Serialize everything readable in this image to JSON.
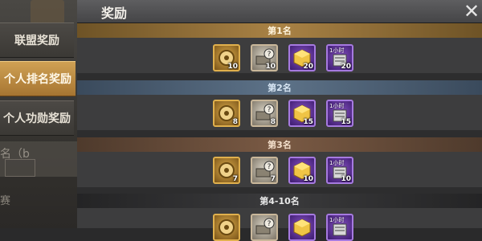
{
  "sidebar": {
    "tabs": [
      {
        "label": "联盟奖励"
      },
      {
        "label": "个人排名奖励"
      },
      {
        "label": "个人功勋奖励"
      }
    ],
    "background_text": [
      "名（b",
      "赛"
    ]
  },
  "panel": {
    "title": "奖励"
  },
  "ranks": [
    {
      "label": "第1名",
      "items": [
        {
          "icon": "gear-medal-icon",
          "count": "10"
        },
        {
          "icon": "mystery-crate-icon",
          "count": "10"
        },
        {
          "icon": "gold-cube-icon",
          "count": "20"
        },
        {
          "icon": "speedup-scroll-icon",
          "count": "20",
          "time_label": "1小时"
        }
      ]
    },
    {
      "label": "第2名",
      "items": [
        {
          "icon": "gear-medal-icon",
          "count": "8"
        },
        {
          "icon": "mystery-crate-icon",
          "count": "8"
        },
        {
          "icon": "gold-cube-icon",
          "count": "15"
        },
        {
          "icon": "speedup-scroll-icon",
          "count": "15",
          "time_label": "1小时"
        }
      ]
    },
    {
      "label": "第3名",
      "items": [
        {
          "icon": "gear-medal-icon",
          "count": "7"
        },
        {
          "icon": "mystery-crate-icon",
          "count": "7"
        },
        {
          "icon": "gold-cube-icon",
          "count": "10"
        },
        {
          "icon": "speedup-scroll-icon",
          "count": "10",
          "time_label": "1小时"
        }
      ]
    },
    {
      "label": "第4-10名",
      "items": [
        {
          "icon": "gear-medal-icon",
          "count": ""
        },
        {
          "icon": "mystery-crate-icon",
          "count": ""
        },
        {
          "icon": "gold-cube-icon",
          "count": ""
        },
        {
          "icon": "speedup-scroll-icon",
          "count": "",
          "time_label": "1小时"
        }
      ]
    }
  ],
  "icons": {
    "close": "close-icon"
  },
  "colors": {
    "accent_gold": "#c99b3c",
    "active_tab": "#b8863e",
    "purple_item": "#6a3aa8"
  }
}
